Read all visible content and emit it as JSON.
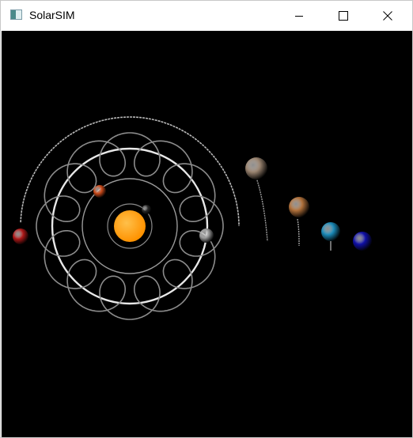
{
  "window": {
    "title": "SolarSIM",
    "controls": {
      "minimize": "minimize",
      "maximize": "maximize",
      "close": "close"
    }
  },
  "scene": {
    "background": "#000000",
    "sun": {
      "color": "#ff9900"
    },
    "bodies": [
      {
        "id": "planet-1",
        "icon": "planet-icon",
        "color": "#2a2a2a"
      },
      {
        "id": "planet-2",
        "icon": "planet-icon",
        "color": "#cc4a1a"
      },
      {
        "id": "planet-3",
        "icon": "planet-icon",
        "color": "#9a9a9a"
      },
      {
        "id": "planet-4",
        "icon": "planet-icon",
        "color": "#b01818"
      },
      {
        "id": "planet-5",
        "icon": "planet-icon",
        "color": "#9a8470"
      },
      {
        "id": "planet-6",
        "icon": "planet-icon",
        "color": "#b0703a"
      },
      {
        "id": "planet-7",
        "icon": "planet-icon",
        "color": "#1a8ab8"
      },
      {
        "id": "planet-8",
        "icon": "planet-icon",
        "color": "#1010a8"
      }
    ]
  }
}
